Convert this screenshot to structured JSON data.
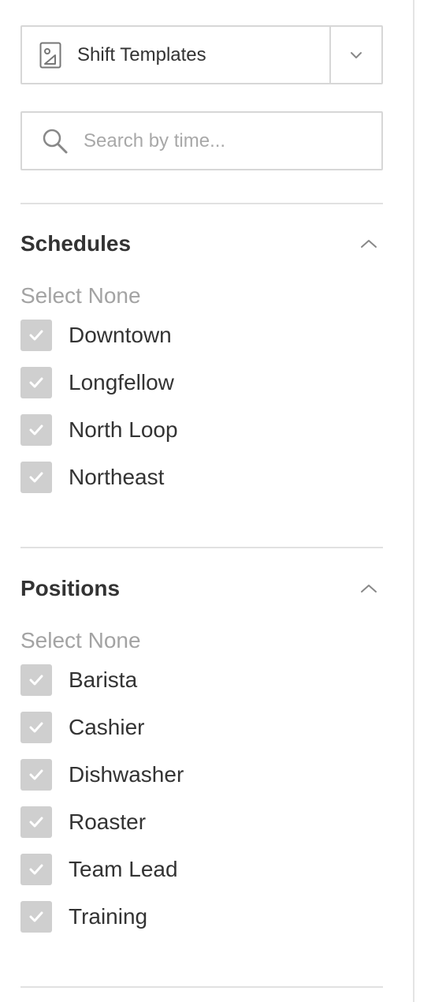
{
  "template_select": {
    "icon": "template-icon",
    "label": "Shift Templates",
    "caret_icon": "chevron-down-icon"
  },
  "search": {
    "icon": "search-icon",
    "placeholder": "Search by time...",
    "value": ""
  },
  "schedules": {
    "title": "Schedules",
    "toggle_icon": "chevron-up-icon",
    "select_none": "Select None",
    "items": [
      {
        "label": "Downtown",
        "checked": true
      },
      {
        "label": "Longfellow",
        "checked": true
      },
      {
        "label": "North Loop",
        "checked": true
      },
      {
        "label": "Northeast",
        "checked": true
      }
    ]
  },
  "positions": {
    "title": "Positions",
    "toggle_icon": "chevron-up-icon",
    "select_none": "Select None",
    "items": [
      {
        "label": "Barista",
        "checked": true
      },
      {
        "label": "Cashier",
        "checked": true
      },
      {
        "label": "Dishwasher",
        "checked": true
      },
      {
        "label": "Roaster",
        "checked": true
      },
      {
        "label": "Team Lead",
        "checked": true
      },
      {
        "label": "Training",
        "checked": true
      }
    ]
  },
  "colors": {
    "checkbox_fill": "#cfcfcf",
    "text": "#333333",
    "muted_text": "#a3a3a3",
    "border": "#d7d7d7"
  }
}
